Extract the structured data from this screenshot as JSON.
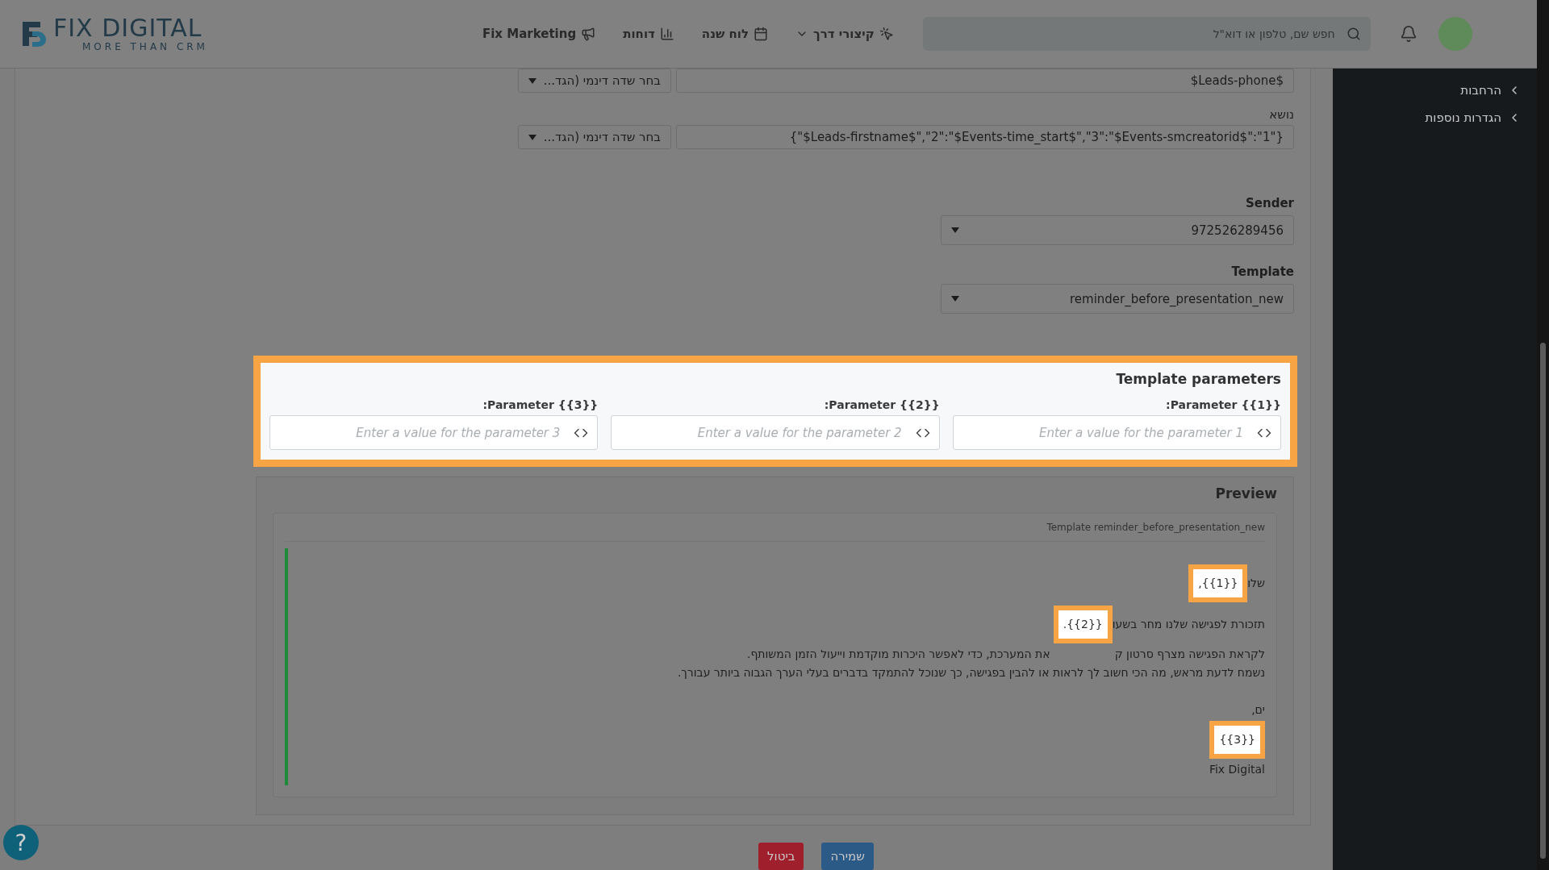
{
  "header": {
    "logo": {
      "name": "FIX DIGITAL",
      "tagline": "MORE THAN CRM"
    },
    "nav": [
      {
        "label": "קיצורי דרך",
        "kind": "shortcut",
        "dropdown": true
      },
      {
        "label": "לוח שנה",
        "kind": "calendar"
      },
      {
        "label": "דוחות",
        "kind": "chart"
      },
      {
        "label": "Fix Marketing",
        "kind": "megaphone"
      }
    ],
    "search": {
      "placeholder": "חפש שם, טלפון או דוא\"ל"
    }
  },
  "sidebar": {
    "items": [
      {
        "label": "הרחבות"
      },
      {
        "label": "הגדרות נוספות"
      }
    ]
  },
  "form": {
    "phone_row": {
      "value": "$Leads-phone$",
      "dynamic_field": "בחר שדה דינמי (הגד..."
    },
    "subject": {
      "label": "נושא",
      "value": "{\"1\":\"$Leads-firstname$\",\"2\":\"$Events-time_start$\",\"3\":\"$Events-smcreatorid$\"}",
      "dynamic_field": "בחר שדה דינמי (הגד..."
    },
    "sender": {
      "label": "Sender",
      "value": "972526289456"
    },
    "template": {
      "label": "Template",
      "value": "reminder_before_presentation_new"
    }
  },
  "template_parameters": {
    "title": "Template parameters",
    "params": [
      {
        "label": "Parameter {{1}}:",
        "placeholder": "Enter a value for the parameter 1"
      },
      {
        "label": "Parameter {{2}}:",
        "placeholder": "Enter a value for the parameter 2"
      },
      {
        "label": "Parameter {{3}}:",
        "placeholder": "Enter a value for the parameter 3"
      }
    ]
  },
  "preview": {
    "title": "Preview",
    "template_name": "Template reminder_before_presentation_new",
    "lines": [
      {
        "segments": [
          "שלו"
        ],
        "badge": "{{1}},"
      },
      {
        "segments": [
          "תזכורת לפגישה שלנו מחר בשעו"
        ],
        "badge": "{{2}}."
      },
      {
        "segments": [
          "לקראת הפגישה מצרף סרטון ק",
          "את המערכת, כדי לאפשר היכרות מוקדמת וייעול הזמן המשותף."
        ]
      },
      {
        "segments": [
          "נשמח לדעת מראש, מה הכי חשוב לך לראות או להבין בפגישה, כך שנוכל להתמקד בדברים בעלי הערך הגבוה ביותר עבורך."
        ]
      },
      {
        "kind": "blank"
      },
      {
        "segments": [
          "ים,"
        ]
      },
      {
        "badge": "{{3}}"
      },
      {
        "segments": [
          "Fix Digital"
        ]
      }
    ]
  },
  "buttons": [
    {
      "label": "שמירה",
      "kind": "primary"
    },
    {
      "label": "ביטול",
      "kind": "danger"
    }
  ],
  "help": {
    "label": "?"
  }
}
